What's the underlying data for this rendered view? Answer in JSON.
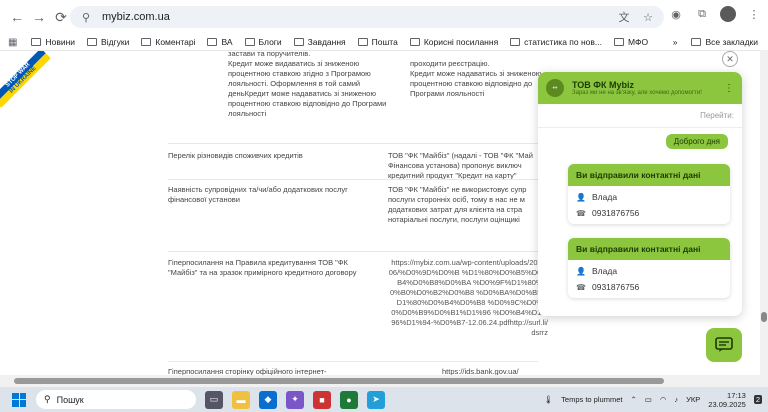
{
  "browser": {
    "url": "mybiz.com.ua",
    "bookmarks": [
      "Новини",
      "Відгуки",
      "Коментарі",
      "ВА",
      "Блоги",
      "Завдання",
      "Пошта",
      "Корисні посилання",
      "статистика по нов...",
      "МФО"
    ],
    "all_bookmarks": "Все закладки"
  },
  "page": {
    "ribbon_line1": "STOP WAR",
    "ribbon_line2": "IN UKRAINE",
    "top_left": "застави та поручителів.\nКредит  може видаватись зі зниженою процентною ставкою згідно з Програмою лояльності. Оформлення в той самий деньКредит може надаватись зі зниженою процентною ставкою відповідно до Програми лояльності",
    "top_right": "проходити реєстрацію.\nКредит може надаватись зі зниженою процентною ставкою відповідно до Програми лояльності",
    "row1_left": "Перелік різновидів споживчих кредитів",
    "row1_right": "ТОВ \"ФК \"Майбіз\" (надалі - ТОВ \"ФК \"Май Фінансова установа) пропонує виключ кредитний продукт \"Кредит на карту\"",
    "row2_left": "Наявність супровідних та/чи/або додаткових послуг фінансової установи",
    "row2_right": "ТОВ \"ФК \"Майбіз\" не використовує супр послуги сторонніх осіб, тому в нас не м додаткових затрат для клієнта на стра нотаріальні послуги, послуги оцінщикі",
    "row3_left": "Гіперпосилання на Правила кредитування ТОВ \"ФК \"Майбіз\" та на зразок примірного кредитного договору",
    "row3_right": "https://mybiz.com.ua/wp-content/uploads/2024/06/%D0%9D%D0%B %D1%80%D0%B5%D0%B4%D0%B8%D0%BA %D0%9F%D1%80%D0%B0%D0%B2%D0%B8 %D0%BA%D0%B5%D1%80%D0%B4%D0%B8 %D0%9C%D0%B0%D0%B9%D0%B1%D1%96 %D0%B4%D1%96%D1%94-%D0%B7-12.06.24.pdfhttp://surl.li/dsrrz",
    "row4_left": "Гіперпосилання сторінку офіційного інтернет-",
    "row4_right": "https://ids.bank.gov.ua/"
  },
  "chat": {
    "title": "ТОВ ФК Mybiz",
    "subtitle": "Зараз ми не на звʼязку, але хочемо допомогти!",
    "goto": "Перейти:",
    "my_message": "Доброго дня",
    "cards": [
      {
        "title": "Ви відправили контактні дані",
        "name": "Влада",
        "phone": "0931876756"
      },
      {
        "title": "Ви відправили контактні дані",
        "name": "Влада",
        "phone": "0931876756"
      }
    ]
  },
  "taskbar": {
    "search": "Пошук",
    "weather": "Temps to plummet",
    "lang": "УКР",
    "time": "17:13",
    "date": "23.09.2025",
    "badge": "2"
  },
  "colors": {
    "accent": "#8cc63f",
    "accent_dark": "#5d8a1f"
  }
}
